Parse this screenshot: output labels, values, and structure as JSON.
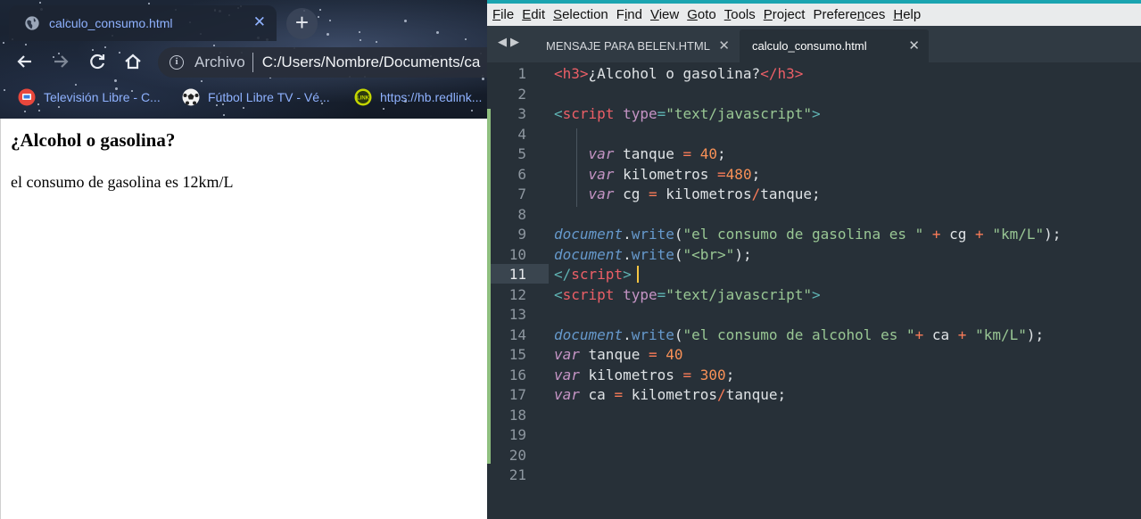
{
  "browser": {
    "tab_title": "calculo_consumo.html",
    "tab_close": "✕",
    "new_tab": "+",
    "omnibox_label": "Archivo",
    "url": "C:/Users/Nombre/Documents/ca",
    "bookmarks": [
      {
        "label": "Televisión Libre - C...",
        "icon": "tv-icon",
        "color": "#e8473c"
      },
      {
        "label": "Fútbol Libre TV - Vé...",
        "icon": "soccer-ball-icon",
        "color": "#f2f2f2"
      },
      {
        "label": "https://hb.redlink...",
        "icon": "link-logo-icon",
        "color": "#c4d600"
      }
    ],
    "page": {
      "heading": "¿Alcohol o gasolina?",
      "text": "el consumo de gasolina es 12km/L"
    }
  },
  "editor": {
    "menu": [
      {
        "u": "F",
        "rest": "ile"
      },
      {
        "u": "E",
        "rest": "dit"
      },
      {
        "u": "S",
        "rest": "election"
      },
      {
        "pre": "F",
        "u": "i",
        "rest": "nd"
      },
      {
        "u": "V",
        "rest": "iew"
      },
      {
        "u": "G",
        "rest": "oto"
      },
      {
        "u": "T",
        "rest": "ools"
      },
      {
        "u": "P",
        "rest": "roject"
      },
      {
        "pre": "Prefere",
        "u": "n",
        "rest": "ces"
      },
      {
        "u": "H",
        "rest": "elp"
      }
    ],
    "tabs": [
      {
        "label": "MENSAJE PARA BELEN.HTML",
        "close": "✕"
      },
      {
        "label": "calculo_consumo.html",
        "close": "✕"
      }
    ],
    "current_line": 11,
    "lines": [
      {
        "n": "1",
        "t": [
          [
            "tag",
            "<h3>"
          ],
          [
            "ident",
            "¿Alcohol o gasolina?"
          ],
          [
            "tag",
            "</h3>"
          ]
        ]
      },
      {
        "n": "2",
        "t": []
      },
      {
        "n": "3",
        "t": [
          [
            "punc",
            "<"
          ],
          [
            "tag",
            "script"
          ],
          [
            "attr",
            " type"
          ],
          [
            "punc",
            "="
          ],
          [
            "str",
            "\"text/javascript\""
          ],
          [
            "punc",
            ">"
          ]
        ]
      },
      {
        "n": "4",
        "t": []
      },
      {
        "n": "5",
        "t": [
          [
            "ident",
            "    "
          ],
          [
            "kw",
            "var"
          ],
          [
            "ident",
            " tanque "
          ],
          [
            "op",
            "="
          ],
          [
            "ident",
            " "
          ],
          [
            "num",
            "40"
          ],
          [
            "ident",
            ";"
          ]
        ]
      },
      {
        "n": "6",
        "t": [
          [
            "ident",
            "    "
          ],
          [
            "kw",
            "var"
          ],
          [
            "ident",
            " kilometros "
          ],
          [
            "op",
            "="
          ],
          [
            "num",
            "480"
          ],
          [
            "ident",
            ";"
          ]
        ]
      },
      {
        "n": "7",
        "t": [
          [
            "ident",
            "    "
          ],
          [
            "kw",
            "var"
          ],
          [
            "ident",
            " cg "
          ],
          [
            "op",
            "="
          ],
          [
            "ident",
            " kilometros"
          ],
          [
            "op",
            "/"
          ],
          [
            "ident",
            "tanque;"
          ]
        ]
      },
      {
        "n": "8",
        "t": []
      },
      {
        "n": "9",
        "t": [
          [
            "obj",
            "document"
          ],
          [
            "ident",
            "."
          ],
          [
            "fn",
            "write"
          ],
          [
            "ident",
            "("
          ],
          [
            "str",
            "\"el consumo de gasolina es \""
          ],
          [
            "ident",
            " "
          ],
          [
            "op",
            "+"
          ],
          [
            "ident",
            " cg "
          ],
          [
            "op",
            "+"
          ],
          [
            "ident",
            " "
          ],
          [
            "str",
            "\"km/L\""
          ],
          [
            "ident",
            ");"
          ]
        ]
      },
      {
        "n": "10",
        "t": [
          [
            "obj",
            "document"
          ],
          [
            "ident",
            "."
          ],
          [
            "fn",
            "write"
          ],
          [
            "ident",
            "("
          ],
          [
            "str",
            "\"<br>\""
          ],
          [
            "ident",
            ");"
          ]
        ]
      },
      {
        "n": "11",
        "t": [
          [
            "punc",
            "</"
          ],
          [
            "tag",
            "script"
          ],
          [
            "punc",
            ">"
          ]
        ]
      },
      {
        "n": "12",
        "t": [
          [
            "punc",
            "<"
          ],
          [
            "tag",
            "script"
          ],
          [
            "attr",
            " type"
          ],
          [
            "punc",
            "="
          ],
          [
            "str",
            "\"text/javascript\""
          ],
          [
            "punc",
            ">"
          ]
        ]
      },
      {
        "n": "13",
        "t": []
      },
      {
        "n": "14",
        "t": [
          [
            "obj",
            "document"
          ],
          [
            "ident",
            "."
          ],
          [
            "fn",
            "write"
          ],
          [
            "ident",
            "("
          ],
          [
            "str",
            "\"el consumo de alcohol es \""
          ],
          [
            "op",
            "+"
          ],
          [
            "ident",
            " ca "
          ],
          [
            "op",
            "+"
          ],
          [
            "ident",
            " "
          ],
          [
            "str",
            "\"km/L\""
          ],
          [
            "ident",
            ");"
          ]
        ]
      },
      {
        "n": "15",
        "t": [
          [
            "kw",
            "var"
          ],
          [
            "ident",
            " tanque "
          ],
          [
            "op",
            "="
          ],
          [
            "ident",
            " "
          ],
          [
            "num",
            "40"
          ]
        ]
      },
      {
        "n": "16",
        "t": [
          [
            "kw",
            "var"
          ],
          [
            "ident",
            " kilometros "
          ],
          [
            "op",
            "="
          ],
          [
            "ident",
            " "
          ],
          [
            "num",
            "300"
          ],
          [
            "ident",
            ";"
          ]
        ]
      },
      {
        "n": "17",
        "t": [
          [
            "kw",
            "var"
          ],
          [
            "ident",
            " ca "
          ],
          [
            "op",
            "="
          ],
          [
            "ident",
            " kilometros"
          ],
          [
            "op",
            "/"
          ],
          [
            "ident",
            "tanque;"
          ]
        ]
      },
      {
        "n": "18",
        "t": []
      },
      {
        "n": "19",
        "t": []
      },
      {
        "n": "20",
        "t": []
      },
      {
        "n": "21",
        "t": []
      }
    ]
  }
}
